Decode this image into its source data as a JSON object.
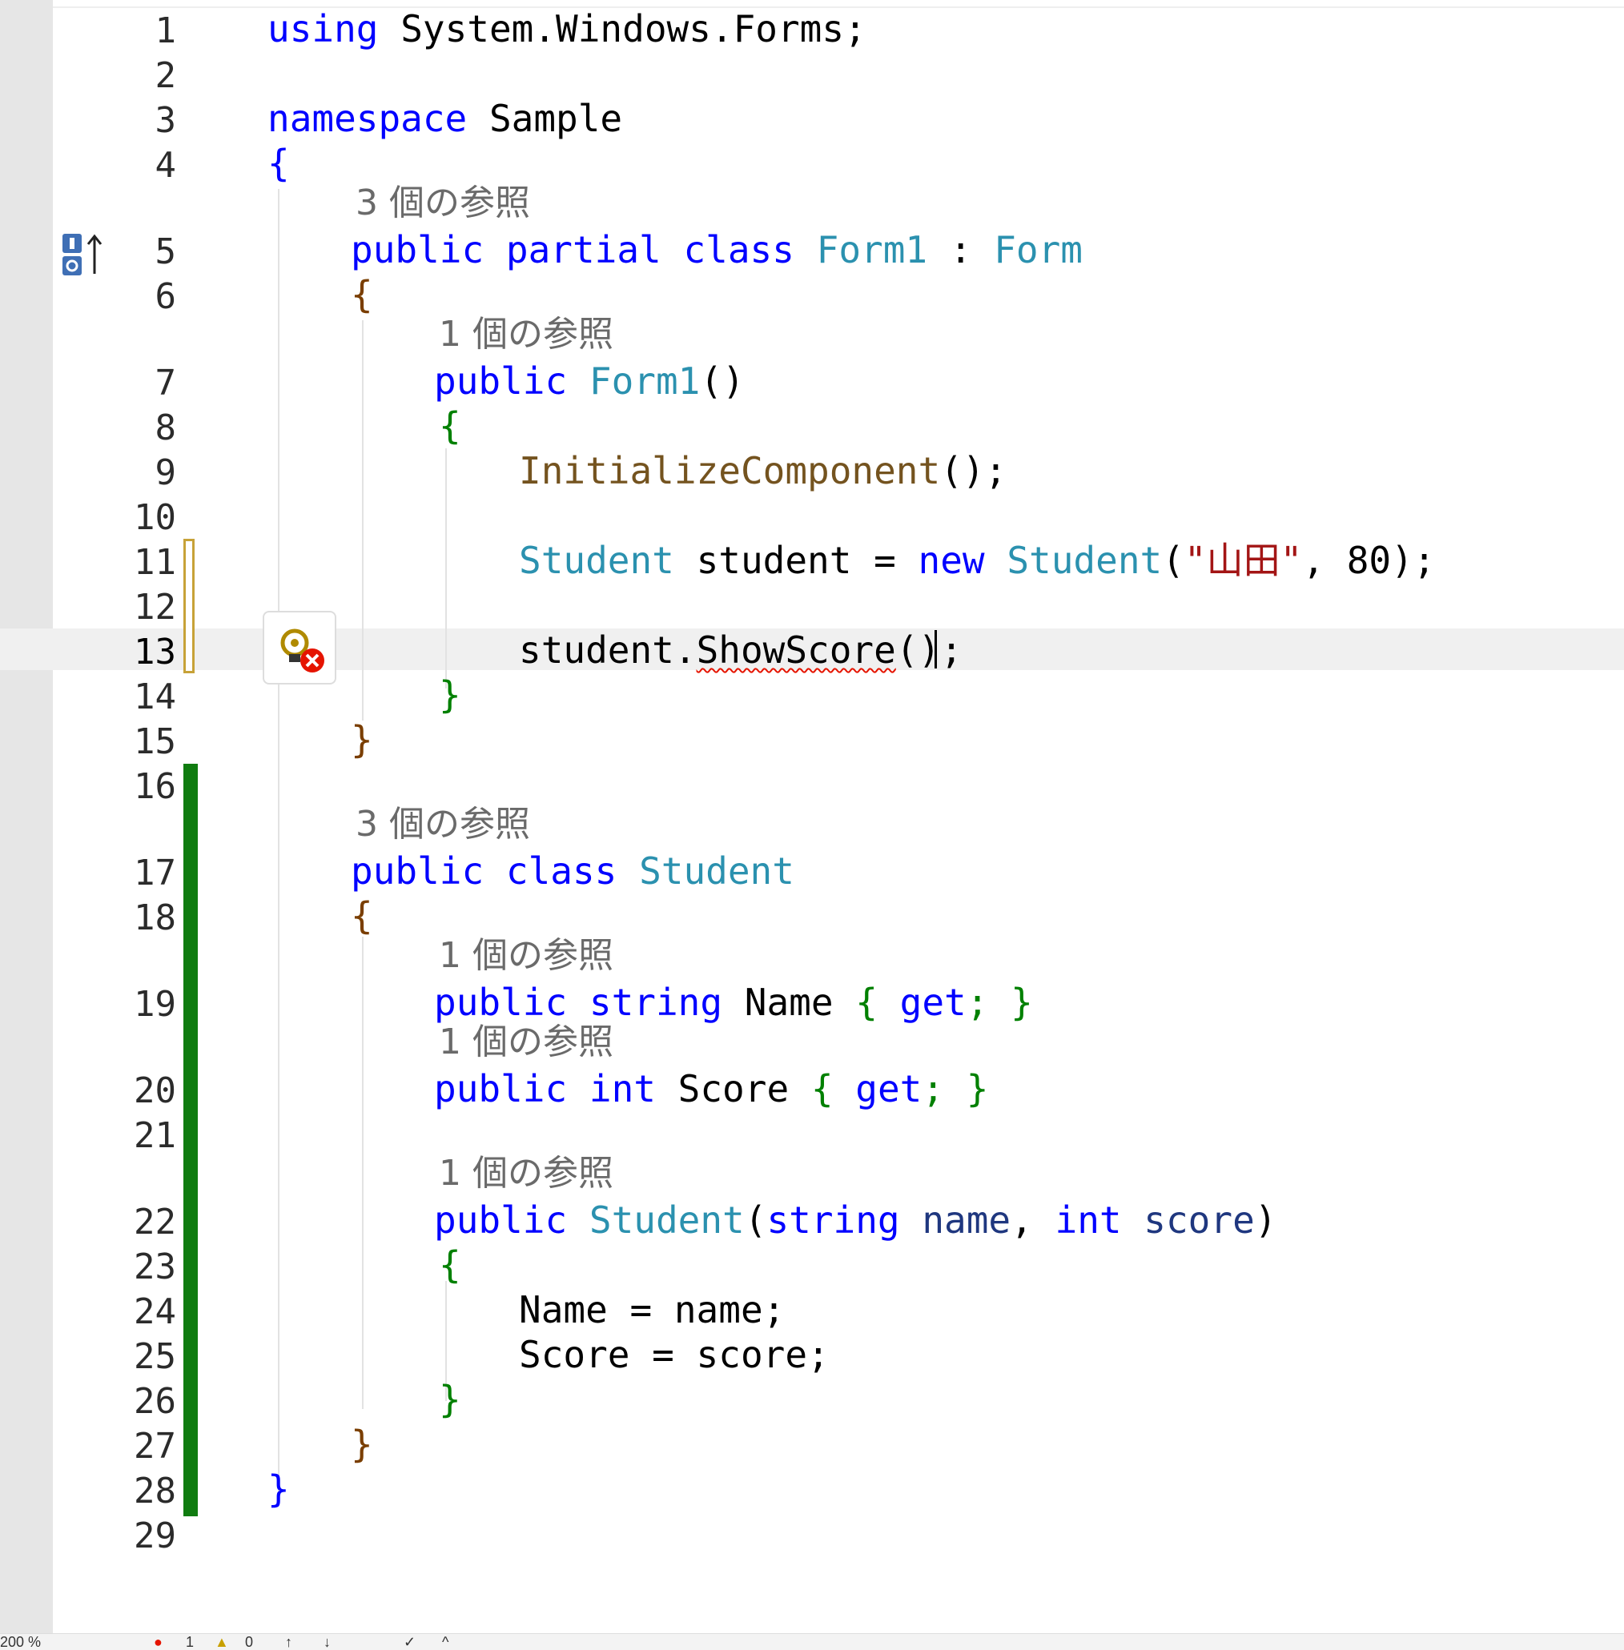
{
  "editor": {
    "line_numbers": [
      "1",
      "2",
      "3",
      "4",
      "5",
      "6",
      "7",
      "8",
      "9",
      "10",
      "11",
      "12",
      "13",
      "14",
      "15",
      "16",
      "17",
      "18",
      "19",
      "20",
      "21",
      "22",
      "23",
      "24",
      "25",
      "26",
      "27",
      "28",
      "29"
    ],
    "codelens": {
      "form1_class": "3 個の参照",
      "form1_ctor": "1 個の参照",
      "student_class": "3 個の参照",
      "name_prop": "1 個の参照",
      "score_prop": "1 個の参照",
      "student_ctor": "1 個の参照"
    },
    "tokens": {
      "using": "using",
      "system_forms": "System.Windows.Forms;",
      "namespace": "namespace",
      "sample": "Sample",
      "open_brace": "{",
      "close_brace": "}",
      "public": "public",
      "partial": "partial",
      "class": "class",
      "form1": "Form1",
      "colon": " : ",
      "form": "Form",
      "parens": "()",
      "init_component": "InitializeComponent",
      "paren_semi": "();",
      "student_type": "Student",
      "student_var": "student",
      "equals": " = ",
      "new": "new",
      "open_paren": "(",
      "string_literal": "\"山田\"",
      "comma_space": ", ",
      "number_80": "80",
      "close_paren_semi": ");",
      "student_dot": "student.",
      "show_score": "ShowScore",
      "string_kw": "string",
      "int_kw": "int",
      "name_prop": "Name",
      "score_prop": "Score",
      "get_block_open": "{ ",
      "get_kw": "get",
      "get_block_close": "; }",
      "name_param": "name",
      "score_param": "score",
      "close_paren": ")",
      "name_assign": "Name = name;",
      "score_assign": "Score = score;"
    }
  },
  "status_bar": {
    "zoom": "200 %",
    "errors": "1",
    "warnings": "0"
  },
  "colors": {
    "keyword": "#0000ff",
    "type": "#2b91af",
    "method": "#74531f",
    "string": "#a31515",
    "change_saved": "#107c10",
    "change_unsaved": "#c7a238",
    "error": "#e51400"
  }
}
